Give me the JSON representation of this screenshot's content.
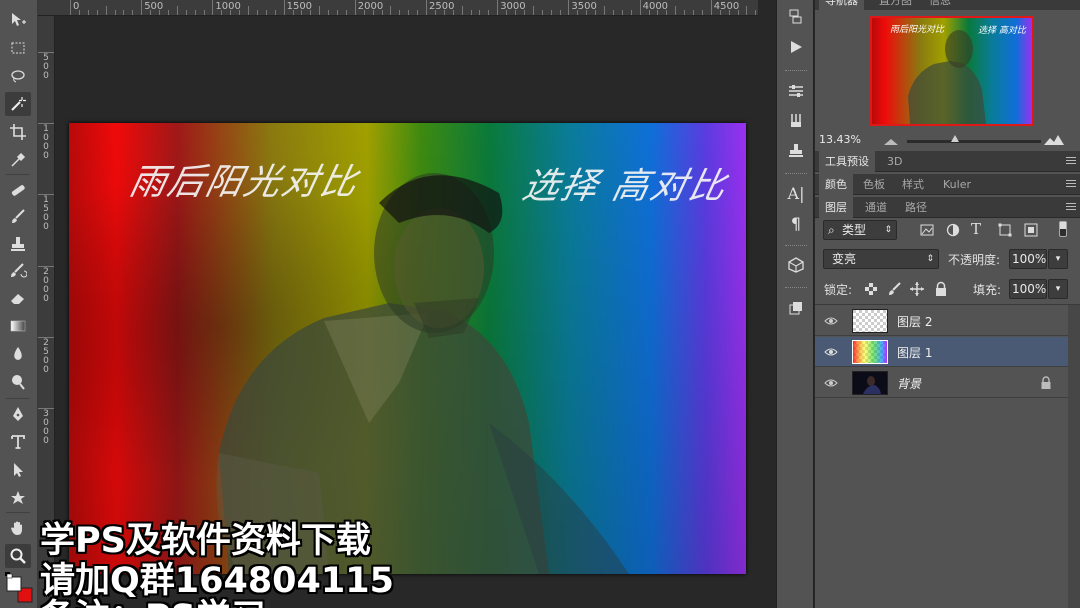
{
  "rulers": {
    "top_labels": [
      "0",
      "500",
      "1000",
      "1500",
      "2000",
      "2500",
      "3000",
      "3500",
      "4000",
      "4500"
    ],
    "left_labels": [
      "5\n0\n0",
      "1\n0\n0\n0",
      "1\n5\n0\n0",
      "2\n0\n0\n0",
      "2\n5\n0\n0",
      "3\n0\n0\n0"
    ]
  },
  "toolbar": {
    "tools": [
      "move-tool",
      "marquee-tool",
      "lasso-tool",
      "magic-wand-tool",
      "crop-tool",
      "eyedropper-tool",
      "healing-brush-tool",
      "brush-tool",
      "clone-stamp-tool",
      "history-brush-tool",
      "eraser-tool",
      "gradient-tool",
      "blur-tool",
      "dodge-tool",
      "pen-tool",
      "type-tool",
      "path-selection-tool",
      "shape-tool",
      "hand-tool",
      "zoom-tool"
    ],
    "active_tool": "magic-wand-tool"
  },
  "canvas": {
    "handwriting_left": "雨后阳光对比",
    "handwriting_right": "选择 高对比"
  },
  "subtitles": {
    "line1": "学PS及软件资料下载",
    "line2": "请加Q群164804115",
    "line3": "备注：PS学习"
  },
  "navigator": {
    "tabs": [
      "导航器",
      "直方图",
      "信息"
    ],
    "zoom": "13.43%"
  },
  "panels": {
    "tabs_row1": [
      "工具预设",
      "3D"
    ],
    "tabs_row2": [
      "颜色",
      "色板",
      "样式",
      "Kuler"
    ],
    "tabs_row3": [
      "图层",
      "通道",
      "路径"
    ]
  },
  "layers": {
    "filter_kind": "类型",
    "blend_mode": "变亮",
    "opacity_label": "不透明度:",
    "opacity_value": "100%",
    "lock_label": "锁定:",
    "fill_label": "填充:",
    "fill_value": "100%",
    "items": [
      {
        "name": "图层 2",
        "visible": true,
        "selected": false
      },
      {
        "name": "图层 1",
        "visible": true,
        "selected": true
      },
      {
        "name": "背景",
        "visible": true,
        "selected": false,
        "locked": true
      }
    ]
  },
  "colors": {
    "selection": "#4a5a74",
    "navigator_box": "#e01818",
    "panel_bg": "#535353"
  }
}
